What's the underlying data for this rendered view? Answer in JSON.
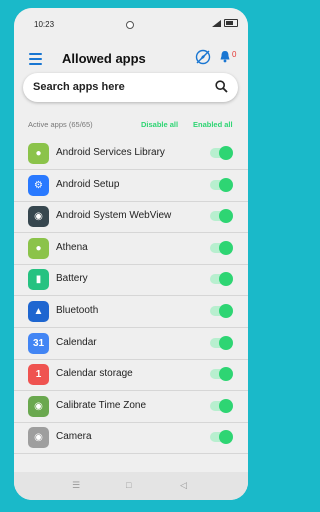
{
  "status": {
    "time": "10:23"
  },
  "header": {
    "title": "Allowed apps",
    "notification_count": "0"
  },
  "search": {
    "placeholder": "Search apps here"
  },
  "controls": {
    "active_count": "Active apps (65/65)",
    "disable_all": "Disable all",
    "enable_all": "Enabled all"
  },
  "apps": [
    {
      "name": "Android Services Library",
      "icon": "android-icon",
      "color": "#8bc34a",
      "enabled": true
    },
    {
      "name": "Android Setup",
      "icon": "gear-icon",
      "color": "#2979ff",
      "enabled": true
    },
    {
      "name": "Android System WebView",
      "icon": "webview-icon",
      "color": "#37474f",
      "enabled": true
    },
    {
      "name": "Athena",
      "icon": "android-icon",
      "color": "#8bc34a",
      "enabled": true
    },
    {
      "name": "Battery",
      "icon": "battery-icon",
      "color": "#26c281",
      "enabled": true
    },
    {
      "name": "Bluetooth",
      "icon": "bluetooth-icon",
      "color": "#1e66d0",
      "enabled": true
    },
    {
      "name": "Calendar",
      "icon": "calendar-icon",
      "color": "#4285f4",
      "enabled": true
    },
    {
      "name": "Calendar storage",
      "icon": "calendar-storage-icon",
      "color": "#ef5350",
      "enabled": true
    },
    {
      "name": "Calibrate Time Zone",
      "icon": "robot-icon",
      "color": "#6aa84f",
      "enabled": true
    },
    {
      "name": "Camera",
      "icon": "camera-icon",
      "color": "#9e9e9e",
      "enabled": true
    }
  ],
  "colors": {
    "accent": "#1976d2",
    "toggle_on": "#2ed573",
    "page_bg": "#1ab9c9"
  }
}
